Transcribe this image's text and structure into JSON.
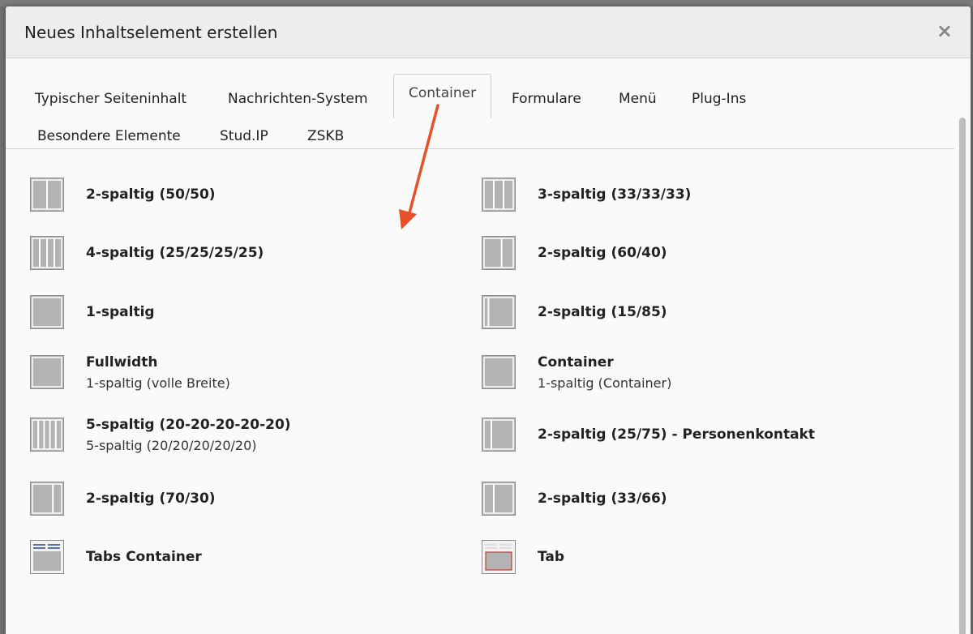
{
  "dialog": {
    "title": "Neues Inhaltselement erstellen",
    "close_label": "×"
  },
  "tabs": [
    {
      "label": "Typischer Seiteninhalt",
      "active": false
    },
    {
      "label": "Nachrichten-System",
      "active": false
    },
    {
      "label": "Container",
      "active": true
    },
    {
      "label": "Formulare",
      "active": false
    },
    {
      "label": "Menü",
      "active": false
    },
    {
      "label": "Plug-Ins",
      "active": false
    },
    {
      "label": "Besondere Elemente",
      "active": false
    },
    {
      "label": "Stud.IP",
      "active": false
    },
    {
      "label": "ZSKB",
      "active": false
    }
  ],
  "items": [
    {
      "title": "2-spaltig (50/50)",
      "desc": "",
      "icon": "columns-2-icon",
      "cols": [
        50,
        50
      ]
    },
    {
      "title": "3-spaltig (33/33/33)",
      "desc": "",
      "icon": "columns-3-icon",
      "cols": [
        33,
        33,
        33
      ]
    },
    {
      "title": "4-spaltig (25/25/25/25)",
      "desc": "",
      "icon": "columns-4-icon",
      "cols": [
        25,
        25,
        25,
        25
      ]
    },
    {
      "title": "2-spaltig (60/40)",
      "desc": "",
      "icon": "columns-2-icon",
      "cols": [
        60,
        40
      ]
    },
    {
      "title": "1-spaltig",
      "desc": "",
      "icon": "columns-1-icon",
      "cols": [
        100
      ]
    },
    {
      "title": "2-spaltig (15/85)",
      "desc": "",
      "icon": "columns-2-icon",
      "cols": [
        15,
        85
      ]
    },
    {
      "title": "Fullwidth",
      "desc": "1-spaltig (volle Breite)",
      "icon": "columns-1-icon",
      "cols": [
        100
      ]
    },
    {
      "title": "Container",
      "desc": "1-spaltig (Container)",
      "icon": "columns-1-icon",
      "cols": [
        100
      ]
    },
    {
      "title": "5-spaltig (20-20-20-20-20)",
      "desc": "5-spaltig (20/20/20/20/20)",
      "icon": "columns-5-icon",
      "cols": [
        20,
        20,
        20,
        20,
        20
      ]
    },
    {
      "title": "2-spaltig (25/75) - Personenkontakt",
      "desc": "",
      "icon": "columns-2-icon",
      "cols": [
        25,
        75
      ]
    },
    {
      "title": "2-spaltig (70/30)",
      "desc": "",
      "icon": "columns-2-icon",
      "cols": [
        70,
        30
      ]
    },
    {
      "title": "2-spaltig (33/66)",
      "desc": "",
      "icon": "columns-2-icon",
      "cols": [
        33,
        66
      ]
    },
    {
      "title": "Tabs Container",
      "desc": "",
      "icon": "tabs-container-icon",
      "cols": []
    },
    {
      "title": "Tab",
      "desc": "",
      "icon": "tab-icon",
      "cols": []
    }
  ],
  "colors": {
    "icon_fill": "#b3b3b3",
    "icon_border": "#8c8c8c",
    "icon_divider": "#ffffff",
    "annotation_arrow": "#e8502a",
    "tab_accent": "#5a6fb0",
    "tab_red": "#c23a3a"
  }
}
